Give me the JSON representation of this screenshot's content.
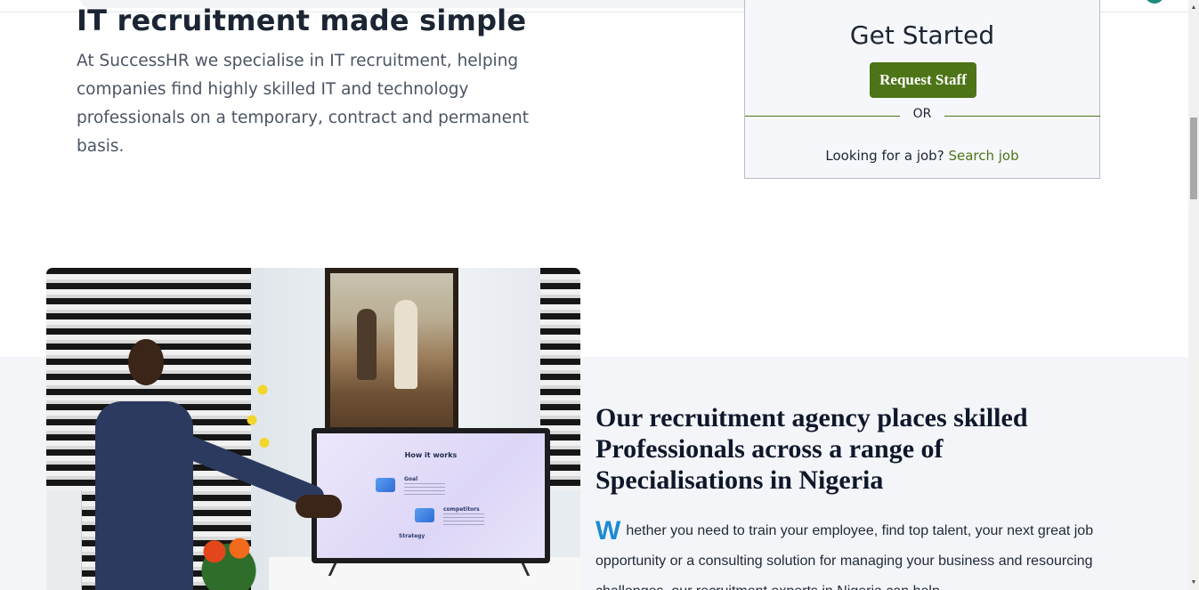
{
  "hero": {
    "title": "IT recruitment made simple",
    "description": "At SuccessHR we specialise in IT recruitment, helping companies find highly skilled IT and technology professionals on a temporary, contract and permanent basis."
  },
  "get_started_card": {
    "title": "Get Started",
    "request_button": "Request Staff",
    "or_text": "OR",
    "job_prompt": "Looking for a job?",
    "job_link": "Search job"
  },
  "photo_screen": {
    "title": "How it works",
    "items": [
      "Goal",
      "competitors",
      "Strategy"
    ]
  },
  "section": {
    "title": "Our recruitment agency places skilled Professionals across a range of Specialisations in Nigeria",
    "drop_cap": "W",
    "body": "hether you need to train your employee, find top talent, your next great job opportunity or a consulting solution for managing your business and resourcing challenges, our recruitment experts in Nigeria can help."
  },
  "scrollbar": {
    "up_arrow": "▲",
    "down_arrow": "▼"
  },
  "colors": {
    "accent_green": "#4d7417",
    "drop_cap_blue": "#1b8ad3",
    "section_bg": "#f4f5f9"
  }
}
